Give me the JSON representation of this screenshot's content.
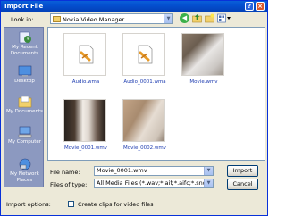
{
  "window": {
    "title": "Import File"
  },
  "toolbar": {
    "look_in_label": "Look in:",
    "look_in_value": "Nokia Video Manager",
    "icons": [
      "back-icon",
      "up-folder-icon",
      "new-folder-icon",
      "views-menu-icon"
    ]
  },
  "places": [
    {
      "label": "My Recent Documents",
      "icon": "recent-documents-icon"
    },
    {
      "label": "Desktop",
      "icon": "desktop-icon"
    },
    {
      "label": "My Documents",
      "icon": "my-documents-icon"
    },
    {
      "label": "My Computer",
      "icon": "my-computer-icon"
    },
    {
      "label": "My Network Places",
      "icon": "network-places-icon"
    }
  ],
  "files": [
    {
      "name": "Audio.wma",
      "kind": "audio"
    },
    {
      "name": "Audio_0001.wma",
      "kind": "audio"
    },
    {
      "name": "Movie.wmv",
      "kind": "video"
    },
    {
      "name": "Movie_0001.wmv",
      "kind": "video"
    },
    {
      "name": "Movie_0002.wmv",
      "kind": "video"
    }
  ],
  "form": {
    "file_name_label": "File name:",
    "file_name_value": "Movie_0001.wmv",
    "file_type_label": "Files of type:",
    "file_type_value": "All Media Files (*.wav;*.aif;*.aifc;*.snd;*.mp",
    "import_options_label": "Import options:",
    "create_clips_label": "Create clips for video files",
    "create_clips_checked": false
  },
  "buttons": {
    "import": "Import",
    "cancel": "Cancel",
    "help": "?",
    "close": "×"
  },
  "colors": {
    "title_bar": "#0450d0",
    "places_bar": "#8c99c0",
    "link_text": "#1c3bb0"
  }
}
